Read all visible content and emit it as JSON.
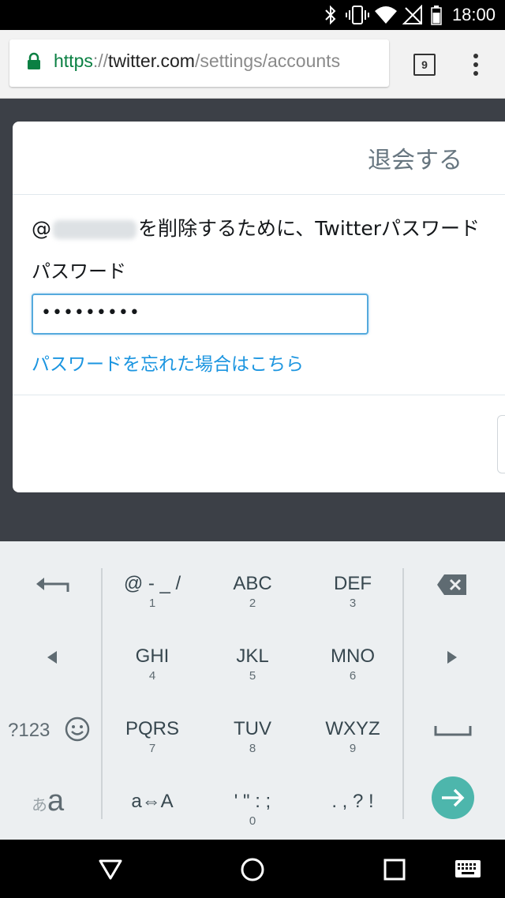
{
  "status_bar": {
    "time": "18:00",
    "icons": [
      "bluetooth-icon",
      "vibrate-icon",
      "wifi-icon",
      "no-signal-icon",
      "battery-icon"
    ]
  },
  "browser": {
    "url_scheme": "https",
    "url_separator": "://",
    "url_host": "twitter.com",
    "url_path": "/settings/accounts",
    "tab_count": "9"
  },
  "dialog": {
    "title": "退会する",
    "prompt_prefix": "@",
    "prompt_suffix": "を削除するために、Twitterパスワード",
    "password_label": "パスワード",
    "password_value": "•••••••••",
    "forgot_link": "パスワードを忘れた場合はこちら"
  },
  "keyboard": {
    "keys": [
      {
        "main": "@ - _ /",
        "sub": "1"
      },
      {
        "main": "ABC",
        "sub": "2"
      },
      {
        "main": "DEF",
        "sub": "3"
      },
      {
        "main": "GHI",
        "sub": "4"
      },
      {
        "main": "JKL",
        "sub": "5"
      },
      {
        "main": "MNO",
        "sub": "6"
      },
      {
        "main": "PQRS",
        "sub": "7"
      },
      {
        "main": "TUV",
        "sub": "8"
      },
      {
        "main": "WXYZ",
        "sub": "9"
      },
      {
        "main": "a⇔A",
        "sub": ""
      },
      {
        "main": "' \" : ;",
        "sub": "0"
      },
      {
        "main": ". , ? !",
        "sub": ""
      }
    ],
    "symbols_label": "?123",
    "kana_small": "あ",
    "kana_large": "a"
  },
  "colors": {
    "accent": "#1b95e0",
    "enter_key": "#4db6ac",
    "secure_green": "#0b8043"
  }
}
